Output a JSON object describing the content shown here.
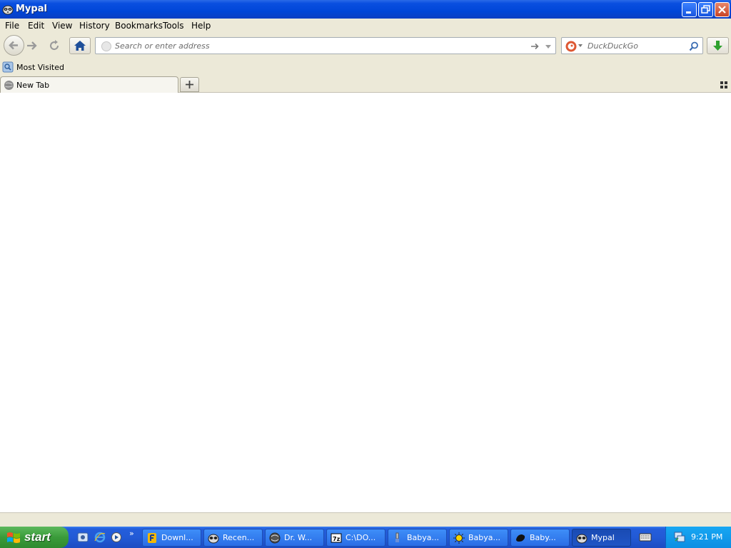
{
  "window": {
    "title": "Mypal"
  },
  "menubar": {
    "items": [
      "File",
      "Edit",
      "View",
      "History",
      "Bookmarks",
      "Tools",
      "Help"
    ]
  },
  "navbar": {
    "url_placeholder": "Search or enter address",
    "search_placeholder": "DuckDuckGo"
  },
  "bookmarks": {
    "items": [
      "Most Visited"
    ]
  },
  "tabs": {
    "items": [
      "New Tab"
    ]
  },
  "taskbar": {
    "start_label": "start",
    "buttons": [
      "Downl...",
      "Recen...",
      "Dr. W...",
      "C:\\DO...",
      "Babya...",
      "Babya...",
      "Baby...",
      "Mypal"
    ],
    "clock": "9:21 PM"
  },
  "colors": {
    "titlebar": "#0046d8",
    "chrome": "#ece9d8",
    "taskbar": "#245edb",
    "start": "#3a9b3a",
    "tray": "#0d8ee3"
  }
}
